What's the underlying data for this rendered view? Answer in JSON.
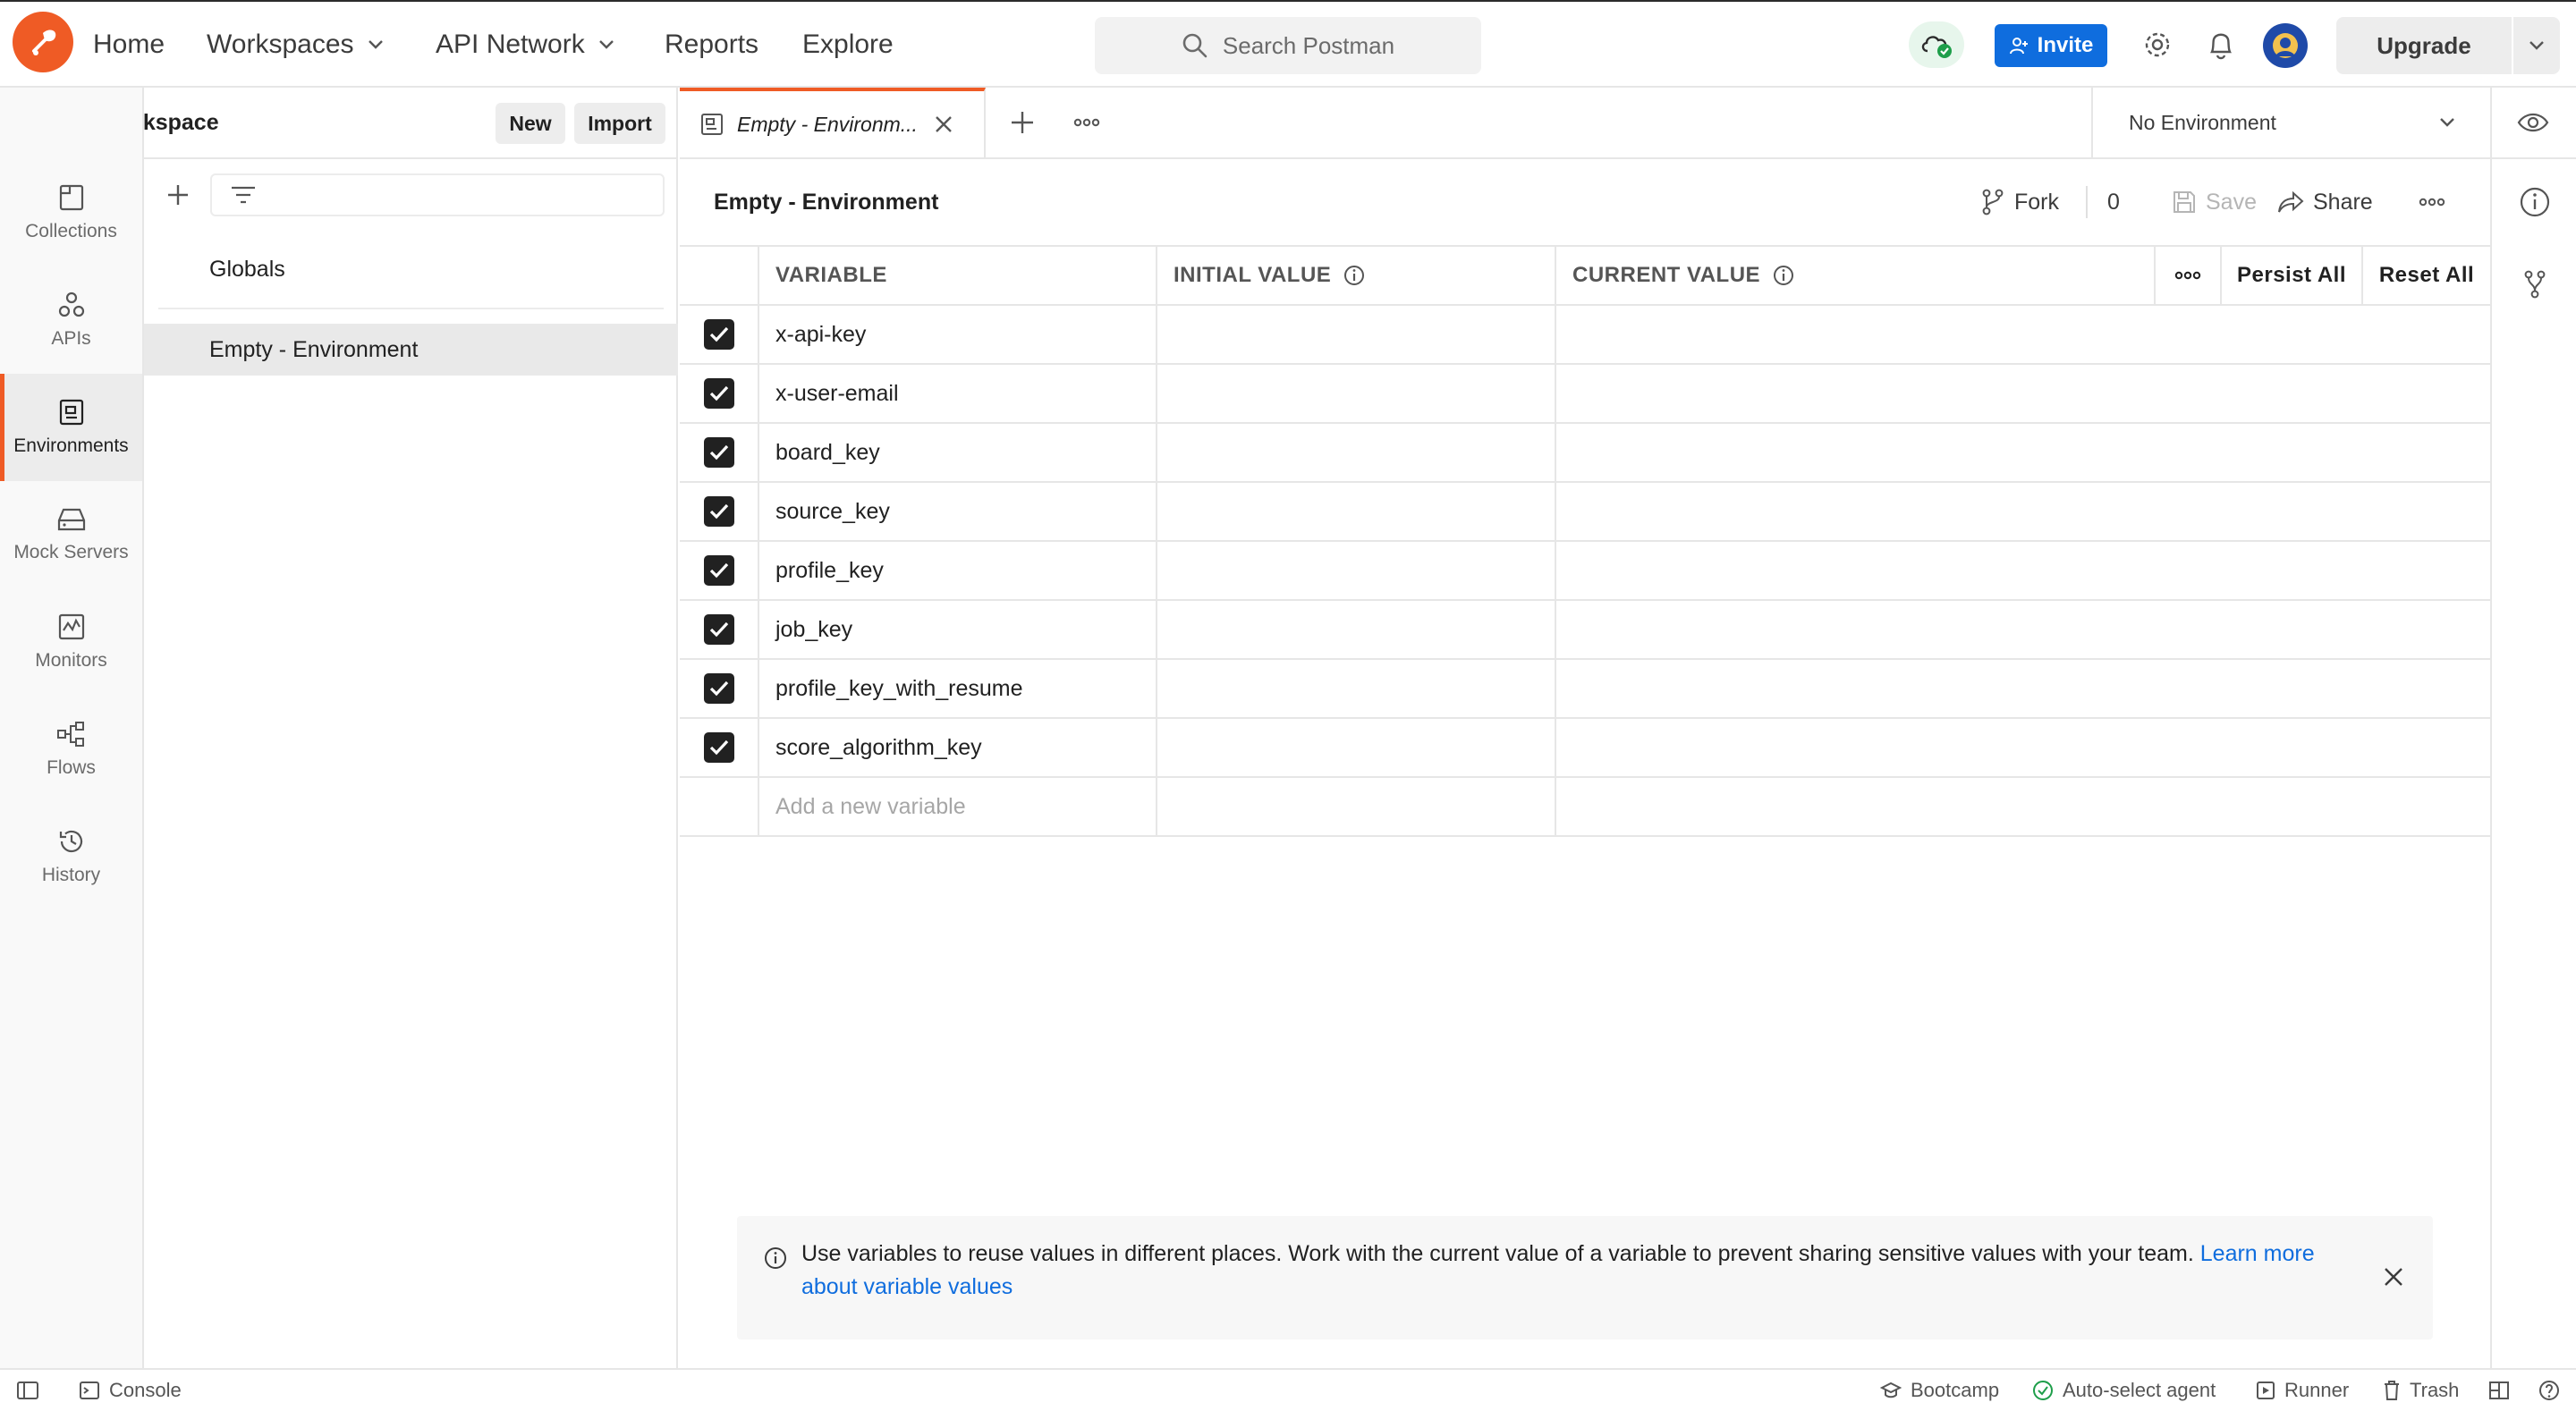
{
  "header": {
    "nav": [
      {
        "label": "Home"
      },
      {
        "label": "Workspaces"
      },
      {
        "label": "API Network"
      },
      {
        "label": "Reports"
      },
      {
        "label": "Explore"
      }
    ],
    "search_placeholder": "Search Postman",
    "invite_label": "Invite",
    "upgrade_label": "Upgrade"
  },
  "workspace": {
    "title": "My Workspace",
    "new_label": "New",
    "import_label": "Import"
  },
  "rail": {
    "items": [
      {
        "label": "Collections",
        "icon": "collections-icon"
      },
      {
        "label": "APIs",
        "icon": "apis-icon"
      },
      {
        "label": "Environments",
        "icon": "environments-icon",
        "active": true
      },
      {
        "label": "Mock Servers",
        "icon": "mock-servers-icon"
      },
      {
        "label": "Monitors",
        "icon": "monitors-icon"
      },
      {
        "label": "Flows",
        "icon": "flows-icon"
      },
      {
        "label": "History",
        "icon": "history-icon"
      }
    ]
  },
  "envlist": {
    "items": [
      {
        "label": "Globals"
      },
      {
        "label": "Empty - Environment",
        "selected": true
      }
    ]
  },
  "tabs": {
    "active_label": "Empty - Environm...",
    "environment_selector": "No Environment"
  },
  "editor": {
    "title": "Empty - Environment",
    "fork_label": "Fork",
    "fork_count": "0",
    "save_label": "Save",
    "share_label": "Share",
    "columns": {
      "variable": "VARIABLE",
      "initial": "INITIAL VALUE",
      "current": "CURRENT VALUE",
      "persist_all": "Persist All",
      "reset_all": "Reset All"
    },
    "rows": [
      {
        "name": "x-api-key",
        "checked": true
      },
      {
        "name": "x-user-email",
        "checked": true
      },
      {
        "name": "board_key",
        "checked": true
      },
      {
        "name": "source_key",
        "checked": true
      },
      {
        "name": "profile_key",
        "checked": true
      },
      {
        "name": "job_key",
        "checked": true
      },
      {
        "name": "profile_key_with_resume",
        "checked": true
      },
      {
        "name": "score_algorithm_key",
        "checked": true
      }
    ],
    "add_placeholder": "Add a new variable"
  },
  "banner": {
    "text": "Use variables to reuse values in different places. Work with the current value of a variable to prevent sharing sensitive values with your team.",
    "link": "Learn more about variable values"
  },
  "status": {
    "console": "Console",
    "bootcamp": "Bootcamp",
    "agent": "Auto-select agent",
    "runner": "Runner",
    "trash": "Trash"
  },
  "colors": {
    "brand": "#ef5b25",
    "primary": "#0f6dde",
    "sync_ok": "#1e9e4a"
  }
}
